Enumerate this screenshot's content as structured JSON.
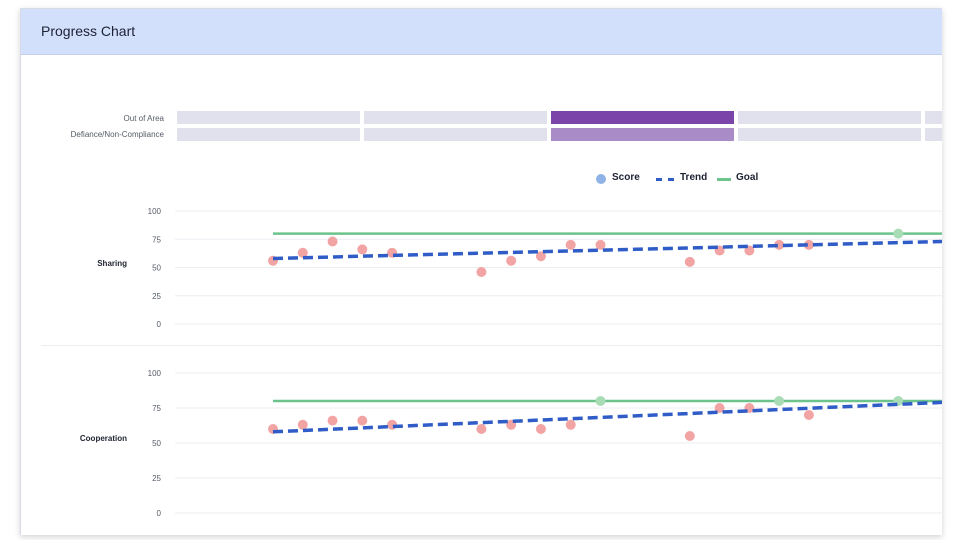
{
  "header": {
    "title": "Progress Chart"
  },
  "behavior_bands": [
    {
      "label": "Out of Area",
      "colors": [
        "#e1e1ed",
        "#e1e1ed",
        "#7a44a8",
        "#e1e1ed",
        "#e1e1ed"
      ]
    },
    {
      "label": "Defiance/Non-Compliance",
      "colors": [
        "#e1e1ed",
        "#e1e1ed",
        "#a98cc7",
        "#e1e1ed",
        "#e1e1ed"
      ]
    }
  ],
  "legend": {
    "score": "Score",
    "trend": "Trend",
    "goal": "Goal"
  },
  "colors": {
    "score": "#f2a4a4",
    "score_goal_met": "#a8dcb5",
    "trend": "#2f5cc6",
    "goal": "#6cc38b",
    "grid": "#eceef2"
  },
  "chart_data": [
    {
      "type": "scatter",
      "title": "Sharing",
      "yticks": [
        0,
        25,
        50,
        75,
        100
      ],
      "ylim": [
        0,
        100
      ],
      "x": [
        1,
        2,
        3,
        4,
        5,
        8,
        9,
        10,
        11,
        12,
        15,
        16,
        17,
        18,
        19,
        22
      ],
      "values": [
        56,
        63,
        73,
        66,
        63,
        46,
        56,
        60,
        70,
        70,
        55,
        65,
        65,
        70,
        70,
        80
      ],
      "trend": [
        58,
        73
      ],
      "goal": 80,
      "xlim": [
        1,
        23
      ]
    },
    {
      "type": "scatter",
      "title": "Cooperation",
      "yticks": [
        0,
        25,
        50,
        75,
        100
      ],
      "ylim": [
        0,
        100
      ],
      "x": [
        1,
        2,
        3,
        4,
        5,
        8,
        9,
        10,
        11,
        12,
        15,
        16,
        17,
        18,
        19,
        22
      ],
      "values": [
        60,
        63,
        66,
        66,
        63,
        60,
        63,
        60,
        63,
        80,
        55,
        75,
        75,
        80,
        70,
        80
      ],
      "trend": [
        58,
        79
      ],
      "goal": 80,
      "xlim": [
        1,
        23
      ]
    }
  ]
}
